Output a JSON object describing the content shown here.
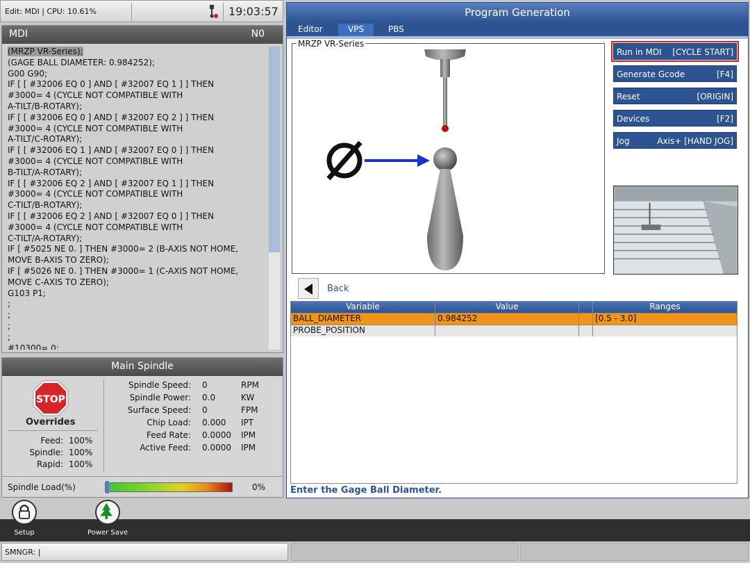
{
  "topbar": {
    "status": "Edit: MDI | CPU: 10.61%",
    "clock": "19:03:57",
    "probe_icon": "probe-icon"
  },
  "mdi": {
    "title": "MDI",
    "n_label": "N0",
    "lines": [
      "(MRZP VR-Series);",
      "(GAGE BALL DIAMETER: 0.984252);",
      "G00 G90;",
      "IF [ [ #32006 EQ 0 ] AND [ #32007 EQ 1 ] ] THEN",
      "#3000= 4 (CYCLE NOT COMPATIBLE WITH",
      "A-TILT/B-ROTARY);",
      "IF [ [ #32006 EQ 0 ] AND [ #32007 EQ 2 ] ] THEN",
      "#3000= 4 (CYCLE NOT COMPATIBLE WITH",
      "A-TILT/C-ROTARY);",
      "IF [ [ #32006 EQ 1 ] AND [ #32007 EQ 0 ] ] THEN",
      "#3000= 4 (CYCLE NOT COMPATIBLE WITH",
      "B-TILT/A-ROTARY);",
      "IF [ [ #32006 EQ 2 ] AND [ #32007 EQ 1 ] ] THEN",
      "#3000= 4 (CYCLE NOT COMPATIBLE WITH",
      "C-TILT/B-ROTARY);",
      "IF [ [ #32006 EQ 2 ] AND [ #32007 EQ 0 ] ] THEN",
      "#3000= 4 (CYCLE NOT COMPATIBLE WITH",
      "C-TILT/A-ROTARY);",
      "IF [ #5025 NE 0. ] THEN #3000= 2 (B-AXIS NOT HOME,",
      "MOVE B-AXIS TO ZERO);",
      "IF [ #5026 NE 0. ] THEN #3000= 1 (C-AXIS NOT HOME,",
      "MOVE C-AXIS TO ZERO);",
      "G103 P1;",
      ";",
      ";",
      ";",
      ";",
      "#10300= 0;"
    ]
  },
  "spindle": {
    "title": "Main Spindle",
    "stop_label": "STOP",
    "overrides_title": "Overrides",
    "overrides": [
      {
        "label": "Feed:",
        "value": "100%"
      },
      {
        "label": "Spindle:",
        "value": "100%"
      },
      {
        "label": "Rapid:",
        "value": "100%"
      }
    ],
    "stats": [
      {
        "label": "Spindle Speed:",
        "value": "0",
        "unit": "RPM"
      },
      {
        "label": "Spindle Power:",
        "value": "0.0",
        "unit": "KW"
      },
      {
        "label": "Surface Speed:",
        "value": "0",
        "unit": "FPM"
      },
      {
        "label": "Chip Load:",
        "value": "0.000",
        "unit": "IPT"
      },
      {
        "label": "Feed Rate:",
        "value": "0.0000",
        "unit": "IPM"
      },
      {
        "label": "Active Feed:",
        "value": "0.0000",
        "unit": "IPM"
      }
    ],
    "load_label": "Spindle Load(%)",
    "load_value": "0%",
    "load_fraction": 0
  },
  "program": {
    "title": "Program Generation",
    "tabs": [
      "Editor",
      "VPS",
      "PBS"
    ],
    "active_tab": "VPS",
    "group_label": "MRZP VR-Series",
    "buttons": [
      {
        "left": "Run in MDI",
        "right": "[CYCLE START]"
      },
      {
        "left": "Generate Gcode",
        "right": "[F4]"
      },
      {
        "left": "Reset",
        "right": "[ORIGIN]"
      },
      {
        "left": "Devices",
        "right": "[F2]"
      },
      {
        "left": "Jog",
        "right": "Axis+ [HAND JOG]"
      }
    ],
    "back_label": "Back",
    "table": {
      "headers": [
        "Variable",
        "Value",
        "",
        "Ranges"
      ],
      "rows": [
        [
          "BALL_DIAMETER",
          "0.984252",
          "",
          "[0.5 - 3.0]"
        ],
        [
          "PROBE_POSITION",
          "",
          "",
          ""
        ]
      ]
    },
    "hint": "Enter the Gage Ball Diameter."
  },
  "nav": {
    "setup": "Setup",
    "power_save": "Power Save"
  },
  "cmdline": {
    "text": "SMNGR: |"
  }
}
